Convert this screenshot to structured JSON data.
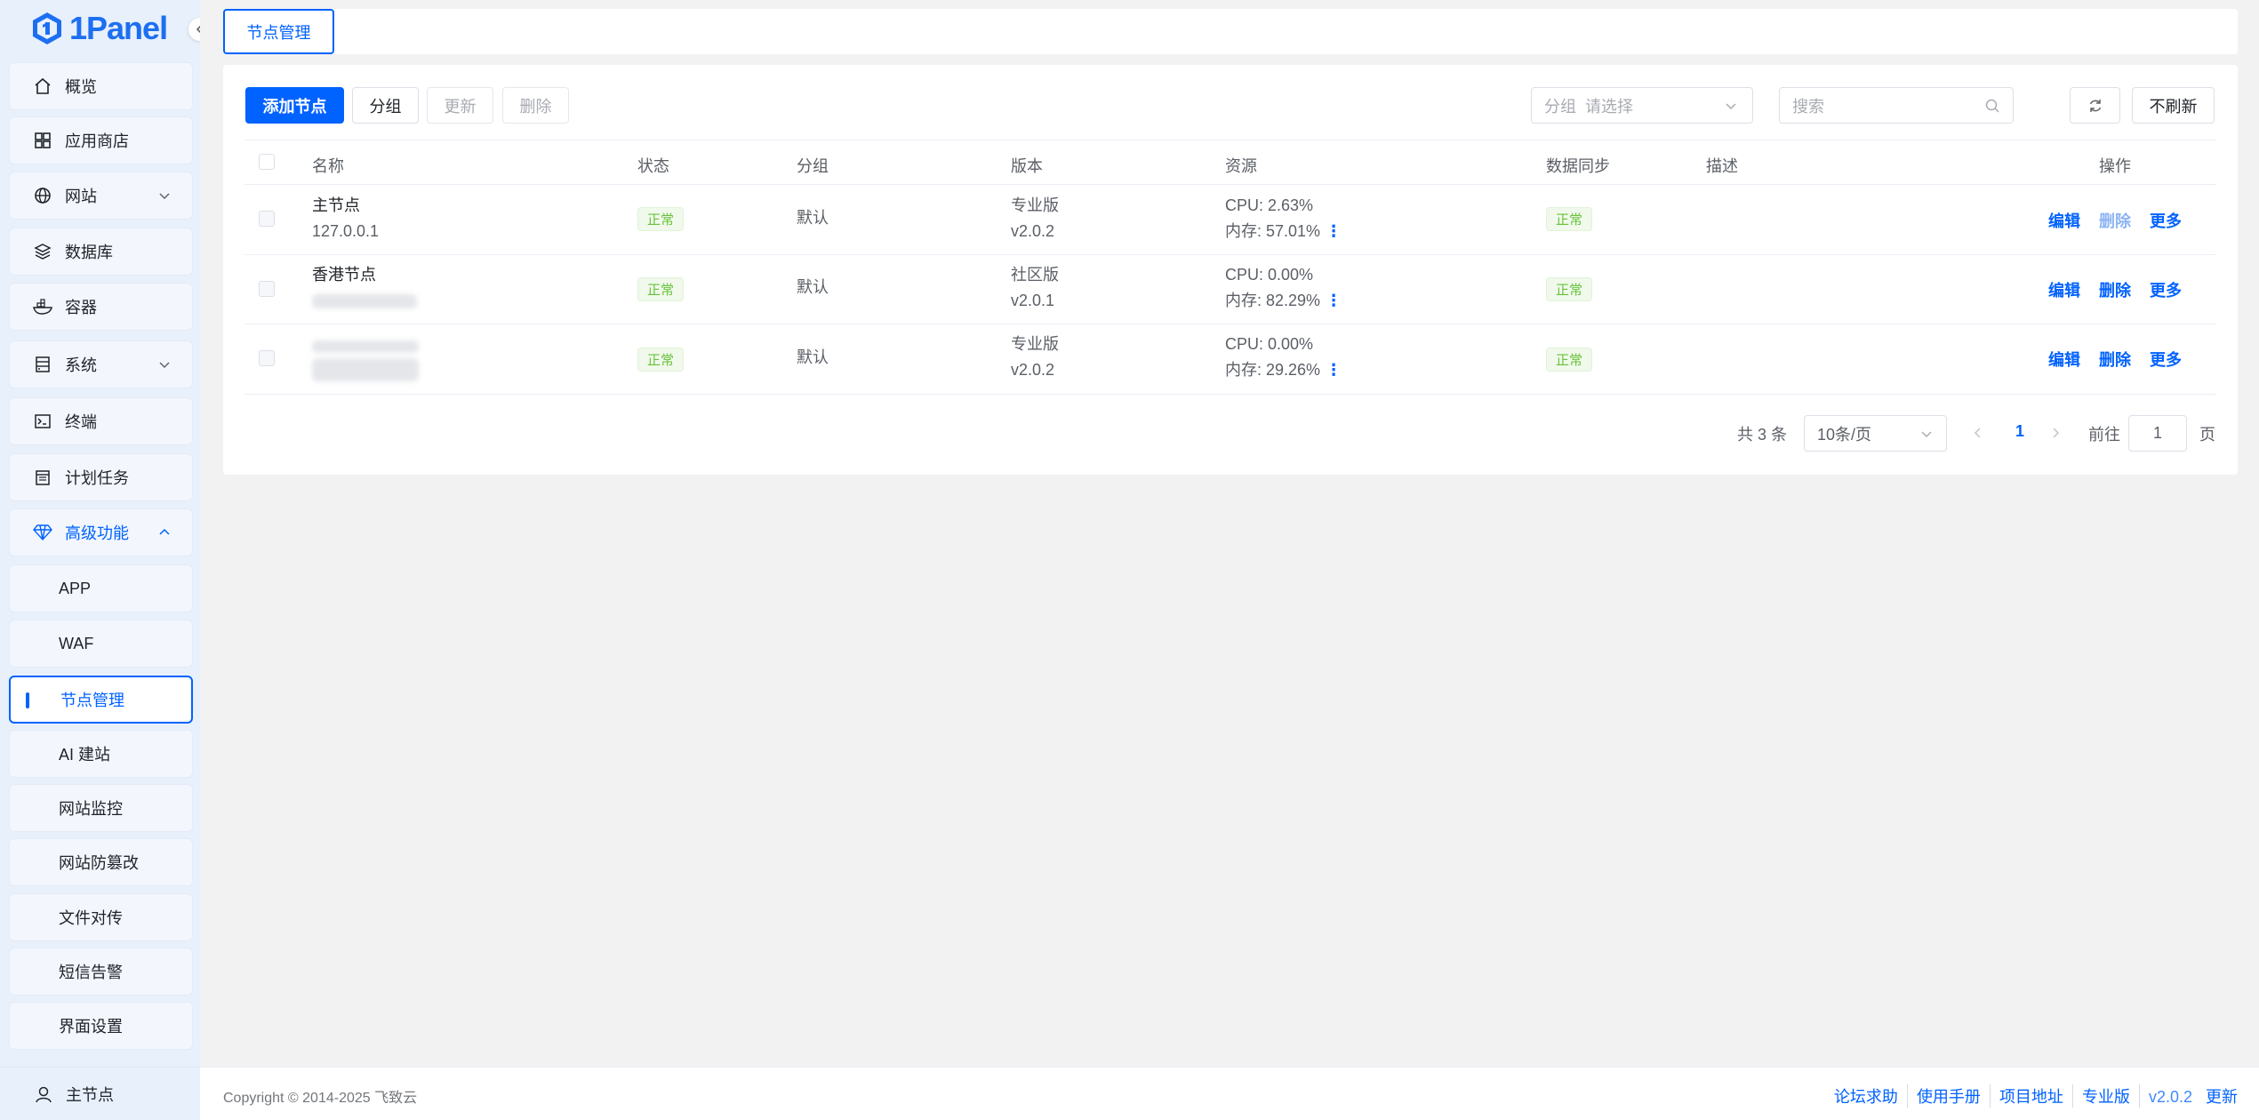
{
  "app": {
    "logo_text": "1Panel"
  },
  "sidebar": {
    "items": [
      {
        "label": "概览",
        "icon": "home-icon"
      },
      {
        "label": "应用商店",
        "icon": "grid-icon"
      },
      {
        "label": "网站",
        "icon": "globe-icon"
      },
      {
        "label": "数据库",
        "icon": "layers-icon"
      },
      {
        "label": "容器",
        "icon": "container-icon"
      },
      {
        "label": "系统",
        "icon": "server-icon"
      },
      {
        "label": "终端",
        "icon": "terminal-icon"
      },
      {
        "label": "计划任务",
        "icon": "calendar-icon"
      },
      {
        "label": "高级功能",
        "icon": "diamond-icon"
      }
    ],
    "sub_items": [
      "APP",
      "WAF",
      "节点管理",
      "AI 建站",
      "网站监控",
      "网站防篡改",
      "文件对传",
      "短信告警",
      "界面设置"
    ],
    "footer_label": "主节点"
  },
  "tabs": {
    "active": "节点管理"
  },
  "toolbar": {
    "add": "添加节点",
    "group": "分组",
    "update": "更新",
    "delete": "删除",
    "group_filter_prefix": "分组",
    "group_filter_placeholder": "请选择",
    "search_placeholder": "搜索",
    "refresh_mode": "不刷新"
  },
  "table": {
    "headers": [
      "名称",
      "状态",
      "分组",
      "版本",
      "资源",
      "数据同步",
      "描述",
      "操作"
    ],
    "rows": [
      {
        "name": "主节点",
        "addr": "127.0.0.1",
        "status": "正常",
        "group": "默认",
        "edition": "专业版",
        "version": "v2.0.2",
        "cpu": "CPU: 2.63%",
        "mem": "内存: 57.01%",
        "sync": "正常",
        "edit": "编辑",
        "delete": "删除",
        "more": "更多"
      },
      {
        "name": "香港节点",
        "addr": "",
        "status": "正常",
        "group": "默认",
        "edition": "社区版",
        "version": "v2.0.1",
        "cpu": "CPU: 0.00%",
        "mem": "内存: 82.29%",
        "sync": "正常",
        "edit": "编辑",
        "delete": "删除",
        "more": "更多"
      },
      {
        "name": "",
        "addr": "",
        "status": "正常",
        "group": "默认",
        "edition": "专业版",
        "version": "v2.0.2",
        "cpu": "CPU: 0.00%",
        "mem": "内存: 29.26%",
        "sync": "正常",
        "edit": "编辑",
        "delete": "删除",
        "more": "更多"
      }
    ]
  },
  "pagination": {
    "total": "共 3 条",
    "page_size": "10条/页",
    "current": "1",
    "goto_prefix": "前往",
    "goto_value": "1",
    "goto_suffix": "页"
  },
  "footer": {
    "copyright": "Copyright © 2014-2025 飞致云",
    "links": [
      "论坛求助",
      "使用手册",
      "项目地址"
    ],
    "edition": "专业版",
    "version": "v2.0.2",
    "update": "更新"
  },
  "colors": {
    "primary": "#0062ff",
    "success": "#67c23a",
    "sidebar_bg": "#e8f0fc"
  }
}
